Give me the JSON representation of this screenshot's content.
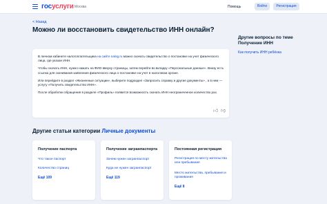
{
  "header": {
    "logo_gos": "гос",
    "logo_uslugi": "услуги",
    "region": "Москва",
    "help": "Помощь",
    "login": "Войти",
    "register": "Регистрация"
  },
  "back": "< Назад",
  "title": "Можно ли восстановить свидетельство ИНН онлайн?",
  "article": {
    "p1_before": "В личном кабинете налогоплательщика ",
    "p1_link": "на сайте nalog.ru",
    "p1_after": " можно скачать свидетельство о постановке на учет физического лица, где указан ИНН.",
    "p2": "Чтобы скачать ИНН, нужно нажать на ФИО вверху страницы, затем перейти во вкладку «Персональные данные». Внизу есть ссылка для скачивания заявления физического лица о постановке на учет в налоговом органе.",
    "p3": "Или перейдите в раздел «Жизненные ситуации», выберите подраздел «Запросить справку и другие документы» , а в нем — услугу «Получить свидетельство ИНН».",
    "p4": "После обработки обращения в разделе «Профиль» появится возможность скачать ИНН неограниченное количество раз"
  },
  "sidebar": {
    "title": "Другие вопросы по теме Получение ИНН",
    "link": "Как получить ИНН ребёнка"
  },
  "section": {
    "title": "Другие статьи категории ",
    "category": "Личные документы"
  },
  "cards": [
    {
      "title": "Получение паспорта",
      "links": [
        "Что такое паспорт",
        "Количество страниц"
      ],
      "all": "Ещё 109"
    },
    {
      "title": "Получение загранпаспорта",
      "links": [
        "Зачем нужен загранпаспорт",
        "Куда не нужен загранпаспорт"
      ],
      "all": "Ещё 119"
    },
    {
      "title": "Постоянная регистрация",
      "links": [
        "Регистрация по месту жительства или пребывания",
        "Место жительства, пребывания и проживания"
      ],
      "all": "Ещё 8"
    }
  ],
  "icons": {
    "like": "thumbs-up-icon",
    "dislike": "thumbs-down-icon",
    "menu": "burger-menu-icon"
  },
  "colors": {
    "accent": "#0d4cd3",
    "logo_red": "#ee3f58",
    "background": "#eef2f8"
  }
}
